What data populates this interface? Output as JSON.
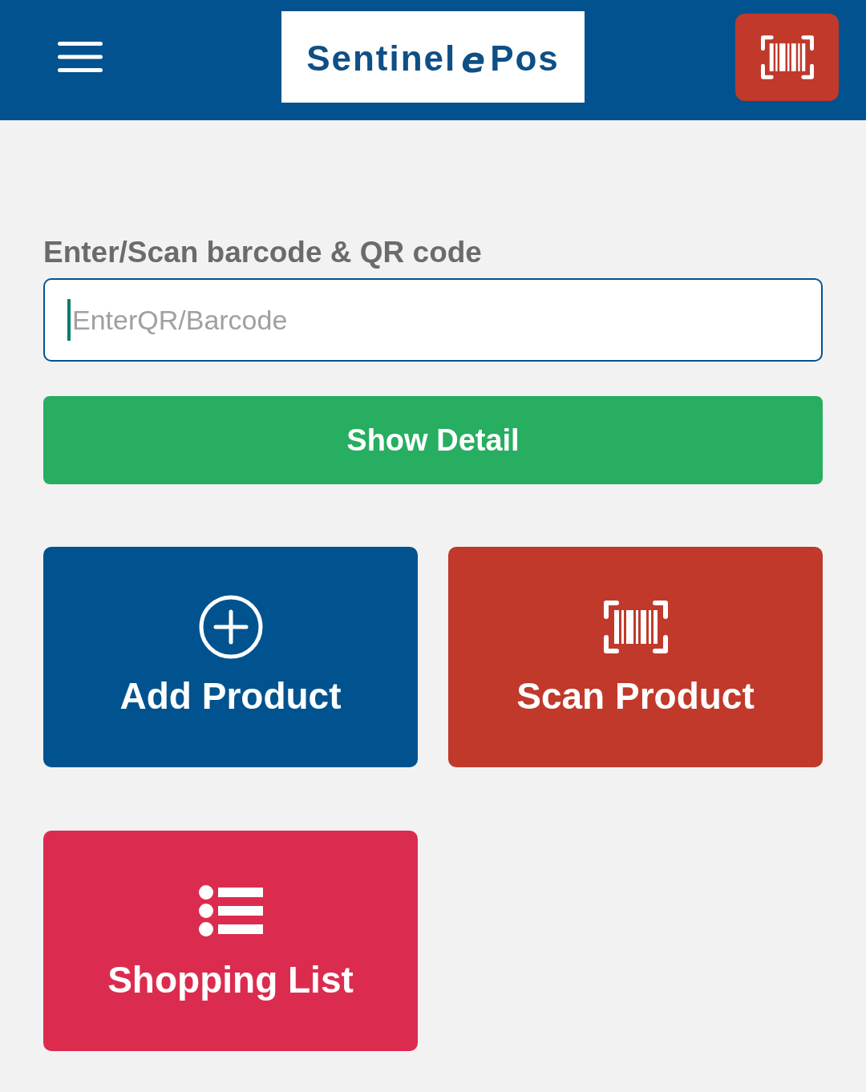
{
  "header": {
    "logo": {
      "wordmark": "Sentinel",
      "emblem_letter": "e",
      "suffix": "Pos"
    }
  },
  "barcode_entry": {
    "label": "Enter/Scan barcode & QR code",
    "placeholder": "EnterQR/Barcode",
    "focused": true
  },
  "show_detail_button": {
    "label": "Show Detail"
  },
  "tiles": [
    {
      "kind": "add",
      "label": "Add Product",
      "color": "#01538f"
    },
    {
      "kind": "scan",
      "label": "Scan Product",
      "color": "#c0392b"
    },
    {
      "kind": "list",
      "label": "Shopping List",
      "color": "#db2c4f"
    }
  ]
}
